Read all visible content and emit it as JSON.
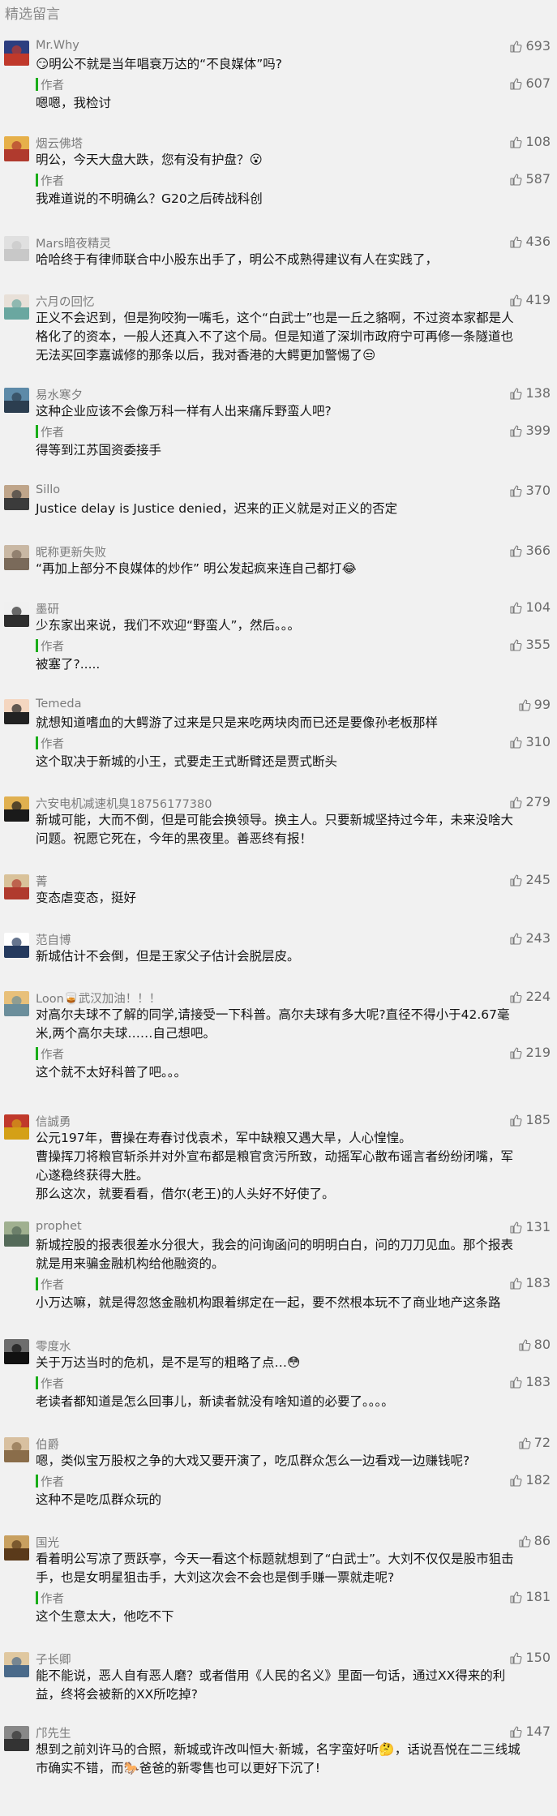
{
  "section_title": "精选留言",
  "author_label": "作者",
  "comments": [
    {
      "nick": "Mr.Why",
      "likes": "693",
      "text": "😏明公不就是当年唱衰万达的“不良媒体”吗?",
      "reply_likes": "607",
      "reply": "嗯嗯，我检讨"
    },
    {
      "nick": "烟云佛塔",
      "likes": "108",
      "text": "明公，今天大盘大跌，您有没有护盘？😮",
      "reply_likes": "587",
      "reply": "我难道说的不明确么？G20之后砖战科创"
    },
    {
      "nick": "Mars暗夜精灵",
      "likes": "436",
      "text": "哈哈终于有律师联合中小股东出手了，明公不成熟得建议有人在实践了，"
    },
    {
      "nick": "六月の回忆",
      "likes": "419",
      "text": "正义不会迟到，但是狗咬狗一嘴毛，这个“白武士”也是一丘之貉啊，不过资本家都是人格化了的资本，一般人还真入不了这个局。但是知道了深圳市政府宁可再修一条隧道也无法买回李嘉诚修的那条以后，我对香港的大鳄更加警惕了😒"
    },
    {
      "nick": "易水寒夕",
      "likes": "138",
      "text": "这种企业应该不会像万科一样有人出来痛斥野蛮人吧?",
      "reply_likes": "399",
      "reply": "得等到江苏国资委接手"
    },
    {
      "nick": "Sillo",
      "likes": "370",
      "text": "Justice delay is Justice denied，迟来的正义就是对正义的否定"
    },
    {
      "nick": "昵称更新失败",
      "likes": "366",
      "text": "“再加上部分不良媒体的炒作” 明公发起疯来连自己都打😂"
    },
    {
      "nick": "墨研",
      "likes": "104",
      "text": "少东家出来说，我们不欢迎“野蛮人”，然后。。。",
      "reply_likes": "355",
      "reply": "被塞了?....."
    },
    {
      "nick": "Temeda",
      "likes": "99",
      "text": "就想知道嗜血的大鳄游了过来是只是来吃两块肉而已还是要像孙老板那样",
      "reply_likes": "310",
      "reply": "这个取决于新城的小王，式要走王式断臂还是贾式断头"
    },
    {
      "nick": "六安电机减速机臭18756177380",
      "likes": "279",
      "text": "新城可能，大而不倒，但是可能会换领导。换主人。只要新城坚持过今年，未来没啥大问题。祝愿它死在，今年的黑夜里。善恶终有报！"
    },
    {
      "nick": "菁",
      "likes": "245",
      "text": "变态虐变态，挺好"
    },
    {
      "nick": "范自博",
      "likes": "243",
      "text": "新城估计不会倒，但是王家父子估计会脱层皮。"
    },
    {
      "nick": "Loon🥃武汉加油！！！",
      "likes": "224",
      "text": "对高尔夫球不了解的同学,请接受一下科普。高尔夫球有多大呢?直径不得小于42.67毫米,两个高尔夫球……自己想吧。",
      "reply_likes": "219",
      "reply": "这个就不太好科普了吧。。。"
    },
    {
      "nick": "信誠勇",
      "likes": "185",
      "text": "公元197年，曹操在寿春讨伐袁术，军中缺粮又遇大旱，人心惶惶。\n曹操挥刀将粮官斩杀并对外宣布都是粮官贪污所致，动摇军心散布谣言者纷纷闭嘴，军心遂稳终获得大胜。\n那么这次，就要看看，借尔(老王)的人头好不好使了。"
    },
    {
      "nick": "prophet",
      "likes": "131",
      "text": "新城控股的报表很差水分很大，我会的问询函问的明明白白，问的刀刀见血。那个报表就是用来骗金融机构给他融资的。",
      "reply_likes": "183",
      "reply": "小万达嘛，就是得忽悠金融机构跟着绑定在一起，要不然根本玩不了商业地产这条路"
    },
    {
      "nick": "零度水",
      "likes": "80",
      "text": "关于万达当时的危机，是不是写的粗略了点…😳",
      "reply_likes": "183",
      "reply": "老读者都知道是怎么回事儿，新读者就没有啥知道的必要了。。。。"
    },
    {
      "nick": "伯爵",
      "likes": "72",
      "text": "嗯，类似宝万股权之争的大戏又要开演了，吃瓜群众怎么一边看戏一边赚钱呢?",
      "reply_likes": "182",
      "reply": "这种不是吃瓜群众玩的"
    },
    {
      "nick": "国光",
      "likes": "86",
      "text": "看着明公写凉了贾跃亭，今天一看这个标题就想到了“白武士”。大刘不仅仅是股市狙击手，也是女明星狙击手，大刘这次会不会也是倒手赚一票就走呢?",
      "reply_likes": "181",
      "reply": "这个生意太大，他吃不下"
    },
    {
      "nick": "子长卿",
      "likes": "150",
      "text": "能不能说，恶人自有恶人磨？或者借用《人民的名义》里面一句话，通过XX得来的利益，终将会被新的XX所吃掉?"
    },
    {
      "nick": "邝先生",
      "likes": "147",
      "text": "想到之前刘许马的合照，新城或许改叫恒大·新城，名字蛮好听🤔，话说吾悦在二三线城市确实不错，而🐎爸爸的新零售也可以更好下沉了!"
    }
  ]
}
